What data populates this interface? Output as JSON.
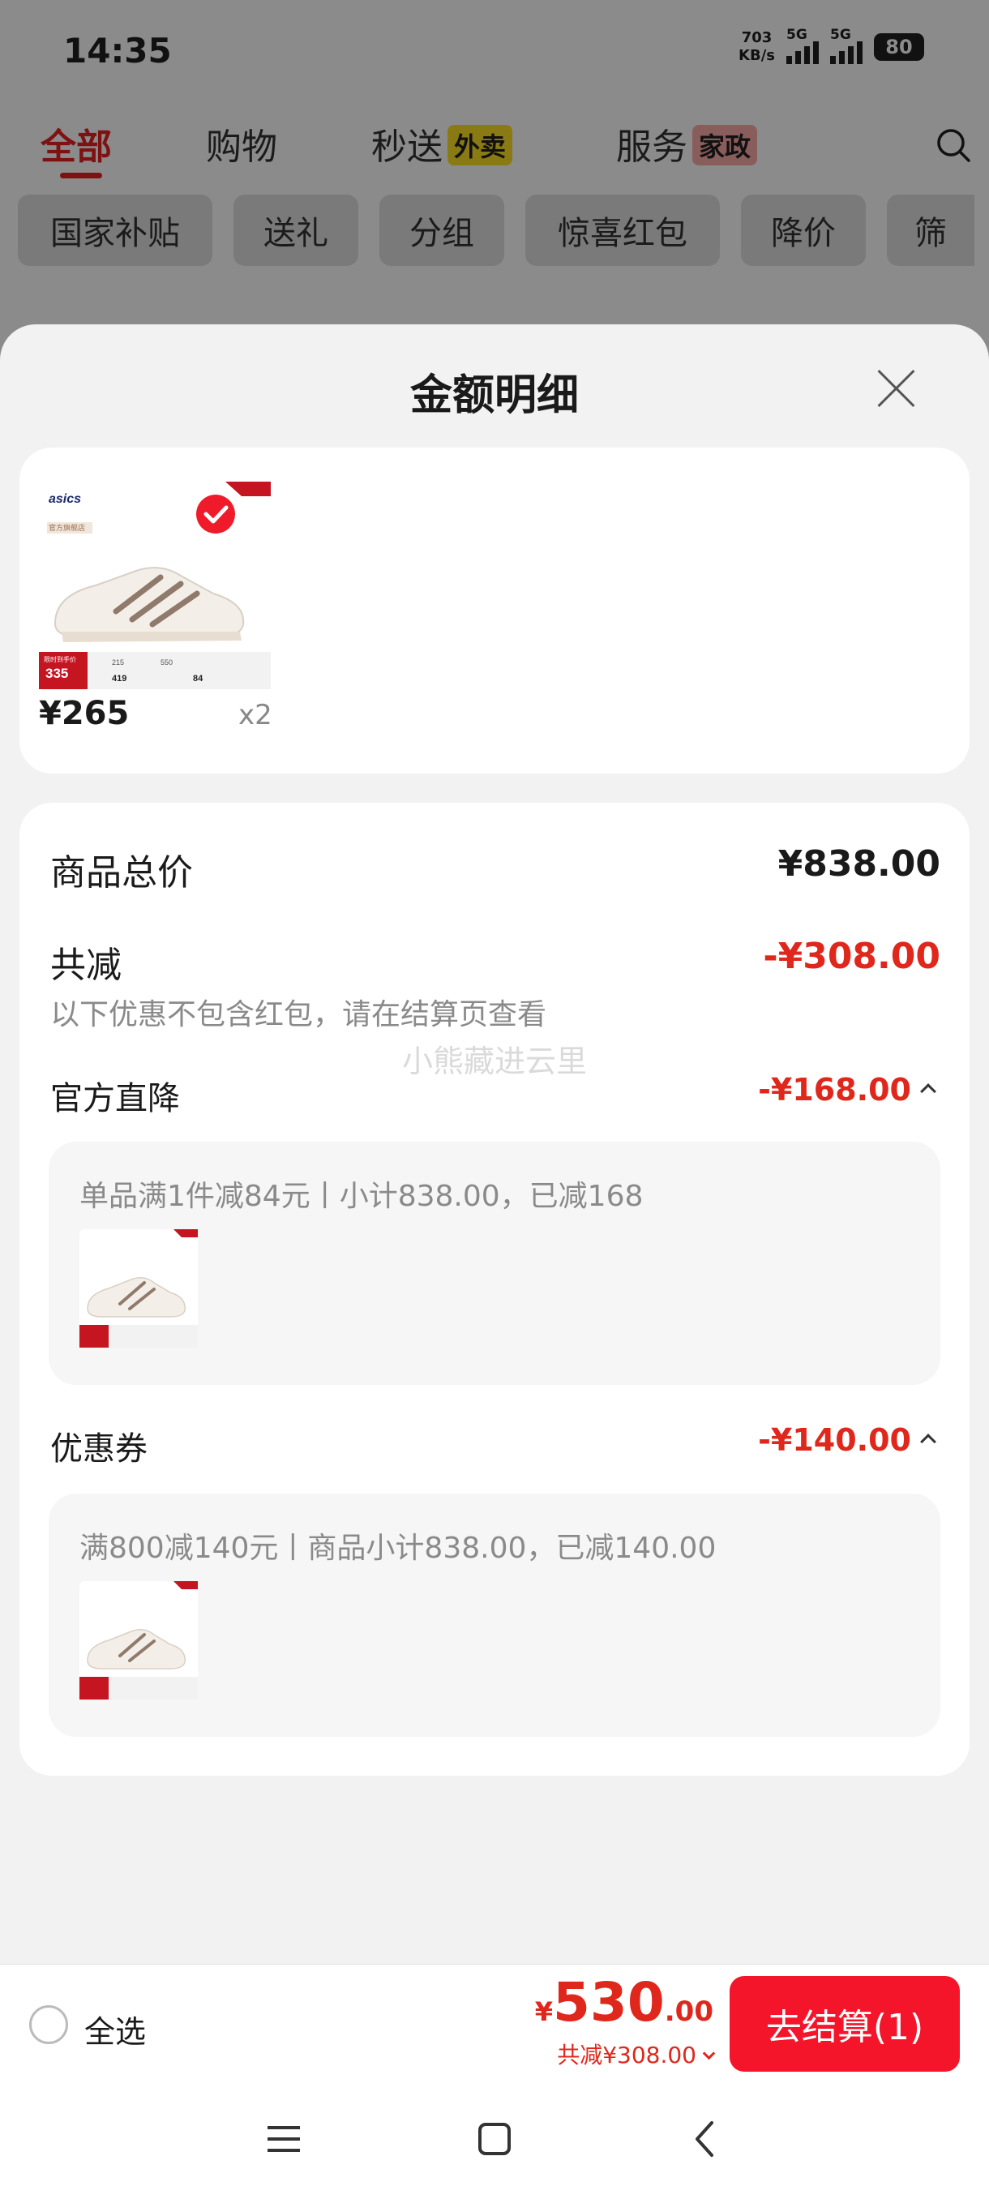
{
  "status_bar": {
    "time": "14:35",
    "net_speed_value": "703",
    "net_speed_unit": "KB/s",
    "sim1_label": "5G",
    "sim2_label": "5G",
    "battery": "80"
  },
  "top_tabs": [
    {
      "label": "全部",
      "active": true
    },
    {
      "label": "购物",
      "active": false
    },
    {
      "label": "秒送",
      "badge": "外卖",
      "active": false
    },
    {
      "label": "服务",
      "badge": "家政",
      "active": false
    }
  ],
  "filter_chips": [
    "国家补贴",
    "送礼",
    "分组",
    "惊喜红包",
    "降价",
    "筛"
  ],
  "sheet": {
    "title": "金额明细",
    "product": {
      "price": "¥265",
      "qty": "x2",
      "image_text": {
        "brand": "asics",
        "tag": "官方旗舰店",
        "promo_label": "限时到手价",
        "promo_price": "335",
        "col1": "215",
        "col2": "419",
        "col3": "550",
        "col4": "84"
      }
    },
    "rows": {
      "total_label": "商品总价",
      "total_value": "¥838.00",
      "reduce_label": "共减",
      "reduce_value": "-¥308.00",
      "reduce_note": "以下优惠不包含红包，请在结算页查看"
    },
    "sections": [
      {
        "label": "官方直降",
        "value": "-¥168.00",
        "detail": "单品满1件减84元丨小计838.00，已减168"
      },
      {
        "label": "优惠券",
        "value": "-¥140.00",
        "detail": "满800减140元丨商品小计838.00，已减140.00"
      }
    ],
    "watermark": "小熊藏进云里"
  },
  "footer": {
    "select_all": "全选",
    "currency": "¥",
    "total_int": "530",
    "total_dec": ".00",
    "reduce_text": "共减¥308.00",
    "checkout": "去结算(1)"
  },
  "colors": {
    "accent_red": "#e0271c",
    "button_red": "#f5152b",
    "active_tab": "#7e1212"
  },
  "icons": [
    "search-icon",
    "check-icon",
    "close-icon",
    "chevron-up-icon",
    "chevron-down-icon",
    "menu-icon",
    "home-icon",
    "back-icon"
  ]
}
